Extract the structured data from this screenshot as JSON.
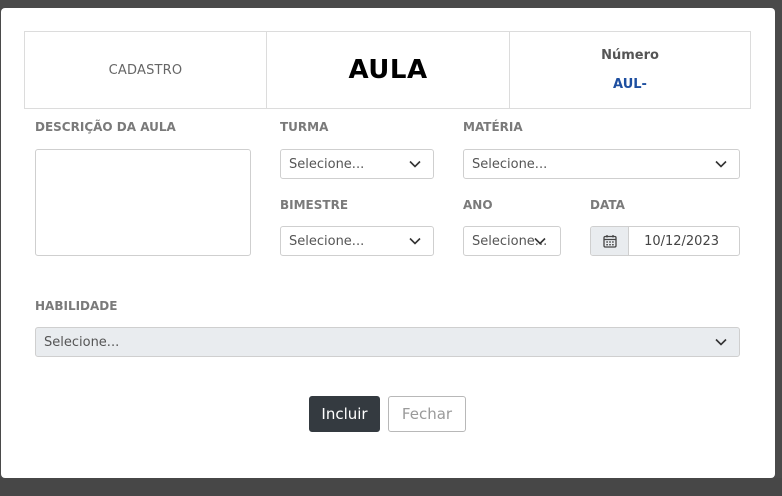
{
  "header": {
    "cadastro": "CADASTRO",
    "title": "AULA",
    "numero_label": "Número",
    "numero_value": "AUL-"
  },
  "form": {
    "descricao_label": "DESCRIÇÃO DA AULA",
    "turma_label": "TURMA",
    "turma_value": "Selecione...",
    "materia_label": "MATÉRIA",
    "materia_value": "Selecione...",
    "bimestre_label": "BIMESTRE",
    "bimestre_value": "Selecione...",
    "ano_label": "ANO",
    "ano_value": "Selecione...",
    "data_label": "DATA",
    "data_value": "10/12/2023",
    "habilidade_label": "HABILIDADE",
    "habilidade_value": "Selecione..."
  },
  "buttons": {
    "incluir": "Incluir",
    "fechar": "Fechar"
  },
  "icons": {
    "calendar": "calendar-icon",
    "chevron": "chevron-down-icon"
  },
  "colors": {
    "primary_button": "#343a40",
    "numero_value": "#1e4fa0",
    "disabled_bg": "#e9ecef"
  }
}
